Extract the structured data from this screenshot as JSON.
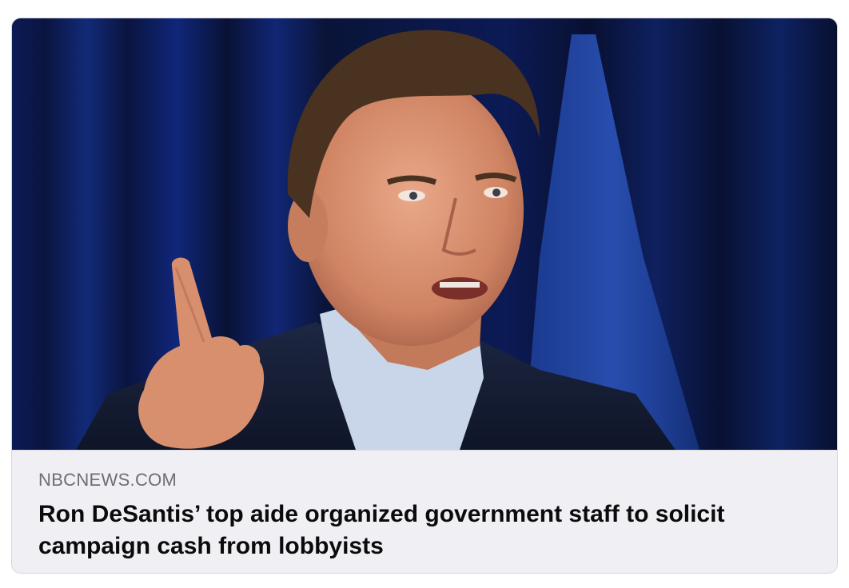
{
  "link_preview": {
    "source": "NBCNEWS.COM",
    "headline": "Ron DeSantis’ top aide organized government staff to solicit campaign cash from lobbyists",
    "image_icon": "news-photo",
    "colors": {
      "card_background": "#f0f0f4",
      "source_text": "#6e6e73",
      "headline_text": "#0b0b0c",
      "backdrop": "#0a1640"
    }
  }
}
